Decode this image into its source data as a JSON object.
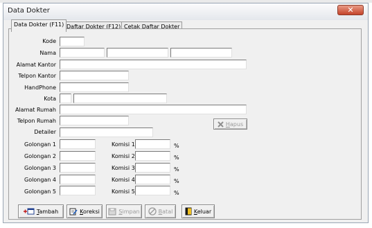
{
  "window": {
    "title": "Data Dokter",
    "close_glyph": "✕"
  },
  "tabs": [
    {
      "label": "Data Dokter (F11)",
      "active": true
    },
    {
      "label": "Daftar Dokter (F12)",
      "active": false
    },
    {
      "label": "Cetak Daftar Dokter",
      "active": false
    }
  ],
  "form": {
    "kode_label": "Kode",
    "nama_label": "Nama",
    "alamat_kantor_label": "Alamat Kantor",
    "telpon_kantor_label": "Telpon Kantor",
    "handphone_label": "HandPhone",
    "kota_label": "Kota",
    "alamat_rumah_label": "Alamat Rumah",
    "telpon_rumah_label": "Telpon Rumah",
    "detailer_label": "Detailer"
  },
  "golongan": [
    {
      "label": "Golongan 1",
      "komisi_label": "Komisi 1",
      "unit": "%"
    },
    {
      "label": "Golongan 2",
      "komisi_label": "Komisi 2",
      "unit": "%"
    },
    {
      "label": "Golongan 3",
      "komisi_label": "Komisi 3",
      "unit": "%"
    },
    {
      "label": "Golongan 4",
      "komisi_label": "Komisi 4",
      "unit": "%"
    },
    {
      "label": "Golongan 5",
      "komisi_label": "Komisi 5",
      "unit": "%"
    }
  ],
  "buttons": {
    "hapus": {
      "hotkey": "H",
      "rest": "apus",
      "enabled": false,
      "icon": "x-icon"
    },
    "tambah": {
      "hotkey": "T",
      "rest": "ambah",
      "enabled": true,
      "icon": "add-record-icon"
    },
    "koreksi": {
      "hotkey": "K",
      "rest": "oreksi",
      "enabled": true,
      "icon": "edit-icon"
    },
    "simpan": {
      "hotkey": "S",
      "rest": "impan",
      "enabled": false,
      "icon": "save-icon"
    },
    "batal": {
      "hotkey": "B",
      "rest": "atal",
      "enabled": false,
      "icon": "cancel-icon"
    },
    "keluar": {
      "hotkey": "K",
      "rest": "eluar",
      "enabled": true,
      "icon": "exit-door-icon"
    }
  },
  "colors": {
    "title_close_red": "#c4442b",
    "exit_icon_yellow": "#f0c020"
  }
}
